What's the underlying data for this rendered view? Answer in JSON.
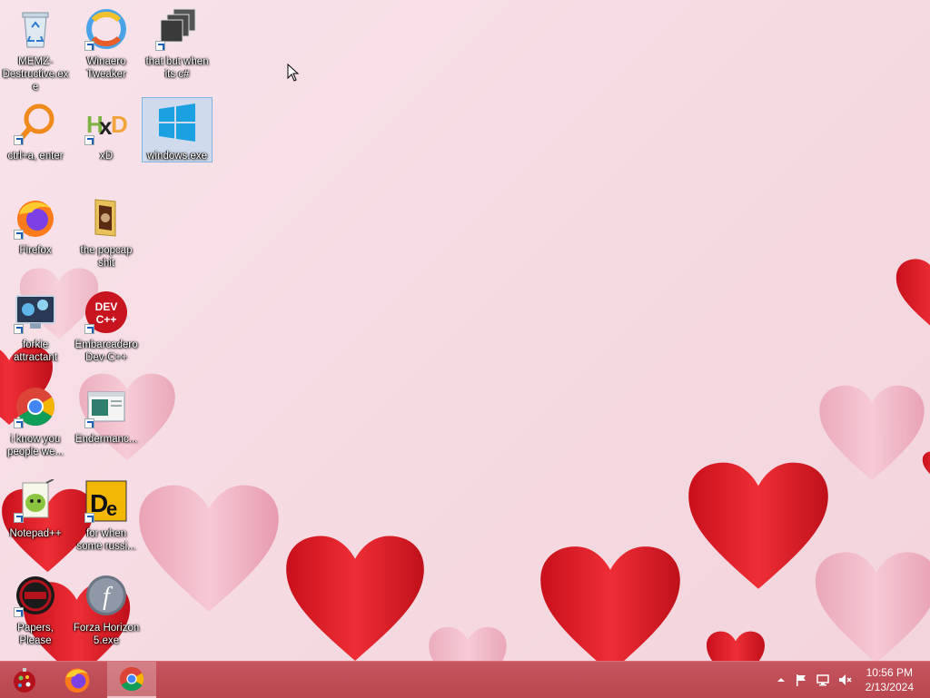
{
  "desktop": {
    "icons": [
      {
        "label": "MEMZ-Destructive.exe"
      },
      {
        "label": "Winaero Tweaker"
      },
      {
        "label": "that but when its c#"
      },
      {
        "label": "ctrl+a, enter"
      },
      {
        "label": "xD"
      },
      {
        "label": "windows.exe"
      },
      {
        "label": "Firefox"
      },
      {
        "label": "the popcap shit"
      },
      {
        "label": "forkie attractant"
      },
      {
        "label": "Embarcadero Dev-C++"
      },
      {
        "label": "i know you people we..."
      },
      {
        "label": "Endermanc..."
      },
      {
        "label": "Notepad++"
      },
      {
        "label": "for when some russi..."
      },
      {
        "label": "Papers, Please"
      },
      {
        "label": "Forza Horizon 5.exe"
      }
    ],
    "selected_icon": "windows.exe"
  },
  "taskbar": {
    "start_icon": "ornament-start-icon",
    "pinned": [
      "firefox-icon",
      "chrome-icon"
    ],
    "active": "chrome-icon",
    "clock": {
      "time": "10:56 PM",
      "date": "2/13/2024"
    },
    "tray_icons": [
      "chevron-up-icon",
      "flag-icon",
      "network-icon",
      "speaker-muted-icon"
    ]
  },
  "colors": {
    "taskbar": "#c04c55",
    "heart_red": "#e3232c",
    "heart_pink": "#f2b7c6"
  }
}
